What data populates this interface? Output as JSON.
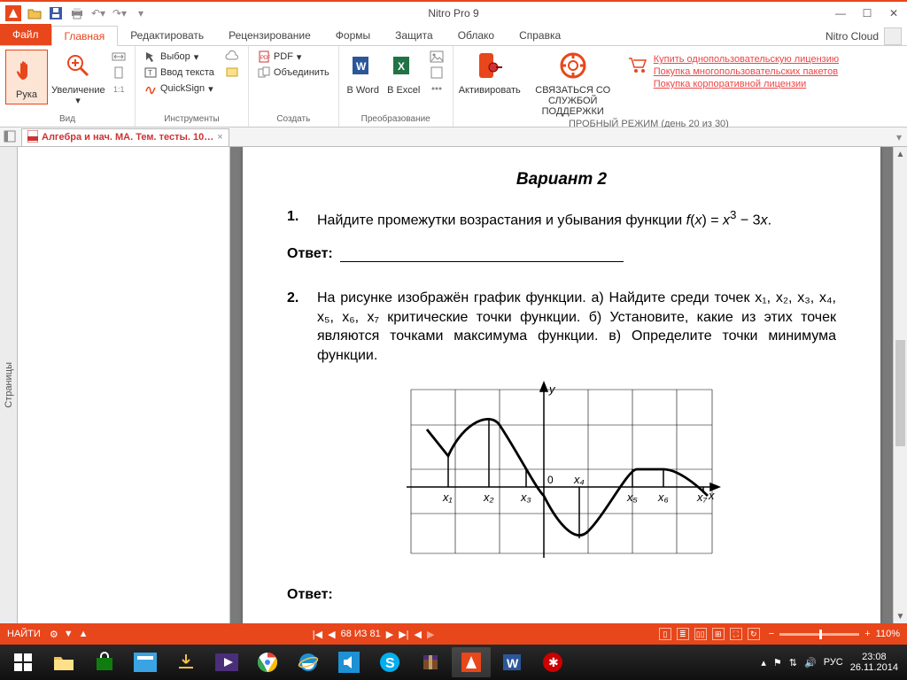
{
  "window": {
    "title": "Nitro Pro 9",
    "cloud_user": "Nitro Cloud"
  },
  "tabs": {
    "file": "Файл",
    "items": [
      "Главная",
      "Редактировать",
      "Рецензирование",
      "Формы",
      "Защита",
      "Облако",
      "Справка"
    ],
    "active": 0
  },
  "ribbon": {
    "view": {
      "hand": "Рука",
      "zoom": "Увеличение",
      "label": "Вид"
    },
    "tools": {
      "select": "Выбор",
      "type": "Ввод текста",
      "sign": "QuickSign",
      "label": "Инструменты"
    },
    "create": {
      "pdf": "PDF",
      "combine": "Объединить",
      "label": "Создать"
    },
    "convert": {
      "word": "В Word",
      "excel": "В Excel",
      "label": "Преобразование"
    },
    "activate": "Активировать",
    "support": "СВЯЗАТЬСЯ СО СЛУЖБОЙ ПОДДЕРЖКИ",
    "links": {
      "single": "Купить однопользовательскую лицензию",
      "multi": "Покупка многопользовательских пакетов",
      "corp": "Покупка корпоративной лицензии"
    },
    "trial": "ПРОБНЫЙ РЕЖИМ (день 20 из 30)"
  },
  "doctab": {
    "title": "Алгебра и нач. МА. Тем. тесты. 10…"
  },
  "sidebar": {
    "label": "Страницы"
  },
  "document": {
    "variant": "Вариант 2",
    "q1_num": "1.",
    "q1_text": "Найдите промежутки возрастания и убывания функции f(x) = x³ − 3x.",
    "answer_label": "Ответ:",
    "q2_num": "2.",
    "q2_text": "На рисунке изображён график функции. а) Найдите среди точек x₁, x₂, x₃, x₄, x₅, x₆, x₇ критические точки функции. б) Установите, какие из этих точек являются точками максимума функции. в) Определите точки минимума функции.",
    "axis_y": "y",
    "axis_x": "x",
    "origin": "0",
    "x_labels": [
      "x₁",
      "x₂",
      "x₃",
      "x₄",
      "x₅",
      "x₆",
      "x₇"
    ]
  },
  "status": {
    "find": "НАЙТИ",
    "page": "68 ИЗ 81",
    "zoom": "110%",
    "lang": "РУС"
  },
  "clock": {
    "time": "23:08",
    "date": "26.11.2014"
  },
  "chart_data": {
    "type": "line",
    "title": "График функции",
    "xlabel": "x",
    "ylabel": "y",
    "x_points": [
      "x1",
      "x2",
      "x3",
      "0",
      "x4",
      "x5",
      "x6",
      "x7"
    ],
    "critical_points": [
      "x1",
      "x2",
      "x4",
      "x5",
      "x6"
    ],
    "maxima": [
      "x2",
      "x6"
    ],
    "minima": [
      "x4"
    ],
    "shape": "piecewise: sharp min at x1, smooth max at x2, decreasing through x3 and 0, smooth min at x4, increasing to plateau between x5 and x6 (flat max), then decreasing to x7",
    "ylim": [
      -2,
      2
    ]
  }
}
